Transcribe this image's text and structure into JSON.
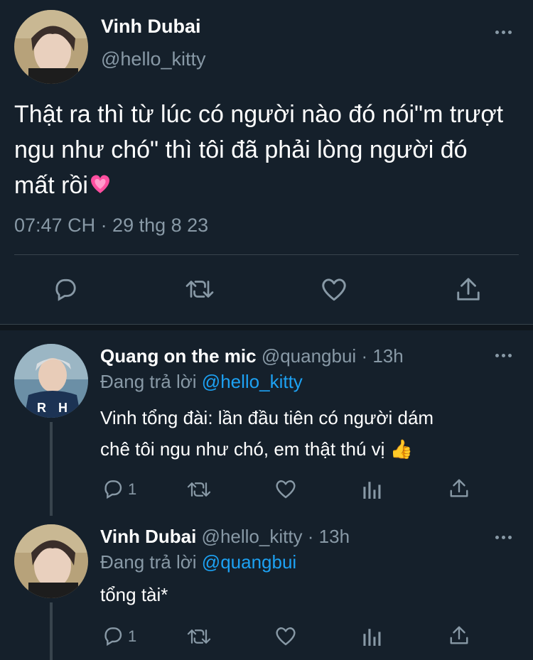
{
  "main_tweet": {
    "author_name": "Vinh Dubai",
    "author_handle": "@hello_kitty",
    "text": "Thật ra thì từ lúc có người nào đó nói\"m trượt ngu như chó\" thì tôi đã phải lòng người đó mất rồi",
    "emoji": "💗",
    "timestamp": "07:47 CH · 29 thg 8 23"
  },
  "replies": [
    {
      "author_name": "Quang on the mic",
      "author_handle": "@quangbui",
      "time": "· 13h",
      "replying_label": "Đang trả lời",
      "replying_to": "@hello_kitty",
      "text_line1": "Vinh tổng đài: lần đầu tiên có người dám",
      "text_line2": "chê tôi ngu như chó, em thật thú vị",
      "emoji": "👍",
      "reply_count": "1"
    },
    {
      "author_name": "Vinh Dubai",
      "author_handle": "@hello_kitty",
      "time": "· 13h",
      "replying_label": "Đang trả lời",
      "replying_to": "@quangbui",
      "text_line1": "tổng tài*",
      "reply_count": "1"
    }
  ],
  "colors": {
    "background": "#15202b",
    "muted": "#8899a6",
    "link": "#1da1f2",
    "divider": "#38444d",
    "heart_emoji": "#ff4fa0"
  }
}
